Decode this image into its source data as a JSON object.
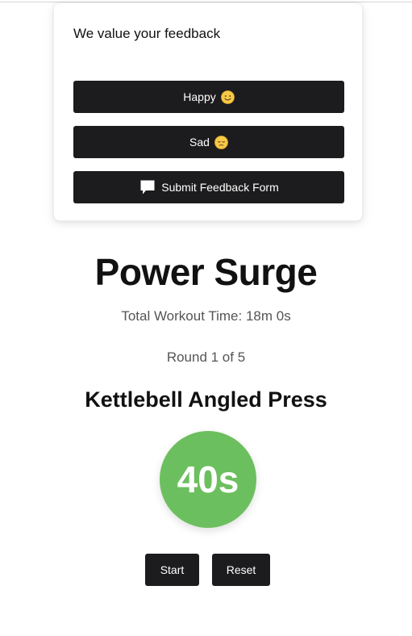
{
  "feedback": {
    "title": "We value your feedback",
    "happy_label": "Happy",
    "happy_icon": "slightly-smiling-face-emoji",
    "sad_label": "Sad",
    "sad_icon": "pensive-face-emoji",
    "submit_label": "Submit Feedback Form",
    "submit_icon": "speech-bubble-icon"
  },
  "workout": {
    "name": "Power Surge",
    "total_time": "Total Workout Time: 18m 0s",
    "round": "Round 1 of 5",
    "exercise": "Kettlebell Angled Press",
    "timer": "40s"
  },
  "controls": {
    "start_label": "Start",
    "reset_label": "Reset"
  },
  "colors": {
    "button_bg": "#1c1c1e",
    "timer_green": "#6cbf5e",
    "muted_text": "#555555"
  }
}
